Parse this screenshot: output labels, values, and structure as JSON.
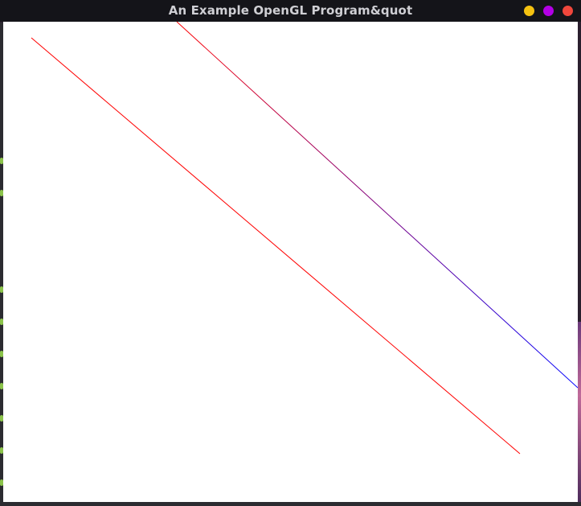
{
  "window": {
    "title": "An Example OpenGL Program&quot"
  },
  "controls": [
    {
      "name": "minimize-button",
      "color": "#f5c211",
      "icon": "circle"
    },
    {
      "name": "maximize-button",
      "color": "#b300e6",
      "icon": "circle"
    },
    {
      "name": "close-button",
      "color": "#f0473c",
      "icon": "circle"
    }
  ],
  "canvas": {
    "background": "#ffffff",
    "lines": [
      {
        "name": "red-line",
        "color": "#ff0000"
      },
      {
        "name": "purple-blue-line",
        "color_start": "#ff0000",
        "color_end": "#0000ff"
      }
    ]
  }
}
